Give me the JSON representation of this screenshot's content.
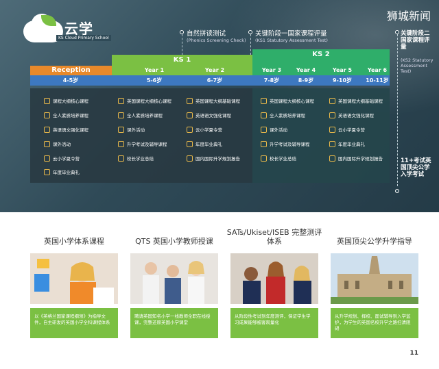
{
  "brand": {
    "logo_name": "云学",
    "logo_sub": "KS Cloud Primary School",
    "news": "狮城新闻"
  },
  "milestones": [
    {
      "title": "自然拼读测试",
      "sub": "(Phonics Screening Check)"
    },
    {
      "title": "关键阶段一国家课程评量",
      "sub": "(KS1 Statutory Assessment Test)"
    },
    {
      "title": "关键阶段二国家课程评量",
      "sub": "(KS2 Statutory Assessment Test)"
    },
    {
      "title": "11+考试英国顶尖公学入学考试"
    }
  ],
  "stages": {
    "reception": "Reception",
    "ks1": "KS 1",
    "ks2": "KS 2"
  },
  "years": [
    "Year 1",
    "Year 2",
    "Year 3",
    "Year 4",
    "Year 5",
    "Year 6"
  ],
  "ages": [
    "4-5岁",
    "5-6岁",
    "6-7岁",
    "7-8岁",
    "8-9岁",
    "9-10岁",
    "10-11岁"
  ],
  "col1": [
    "课程大纲核心课程",
    "全人素质培养课程",
    "英语语文强化课程",
    "课外活动",
    "云小学夏令营",
    "年度毕业典礼"
  ],
  "col2": [
    "英国课程大纲核心课程",
    "全人素质培养课程",
    "课外活动",
    "升学考试及辅导课程",
    "校长学业总结"
  ],
  "col3": [
    "英国课程大纲基础课程",
    "英语语文强化课程",
    "云小学夏令营",
    "年度毕业典礼",
    "国内国际升学规划报告"
  ],
  "col4": [
    "英国课程大纲核心课程",
    "全人素质培养课程",
    "课外活动",
    "升学考试及辅导课程",
    "校长学业总结"
  ],
  "col5": [
    "英国课程大纲基础课程",
    "英语语文强化课程",
    "云小学夏令营",
    "年度毕业典礼",
    "国内国际升学规划报告"
  ],
  "features": [
    {
      "title": "英国小学体系课程",
      "caption": "以《英格兰国家课程纲领》为指导文件，自主研发的英国小学全科课程体系"
    },
    {
      "title": "QTS 英国小学教师授课",
      "caption": "聘请英国知名小学一线教师全职在线授课，完整还原英国小学课堂"
    },
    {
      "title": "SATs/Ukiset/ISEB 完整测评体系",
      "caption": "从阶段性考试到年度测评，保证学生学习成果能够被客观量化"
    },
    {
      "title": "英国顶尖公学升学指导",
      "caption": "从升学规划、择校、面试辅导到入学监护，为学生的英国名校升学之路扫清阻碍"
    }
  ],
  "page_number": "11",
  "colors": {
    "green": "#7bc043",
    "blue": "#3d78c0",
    "orange": "#e8892b",
    "dark": "#2f4a57"
  }
}
